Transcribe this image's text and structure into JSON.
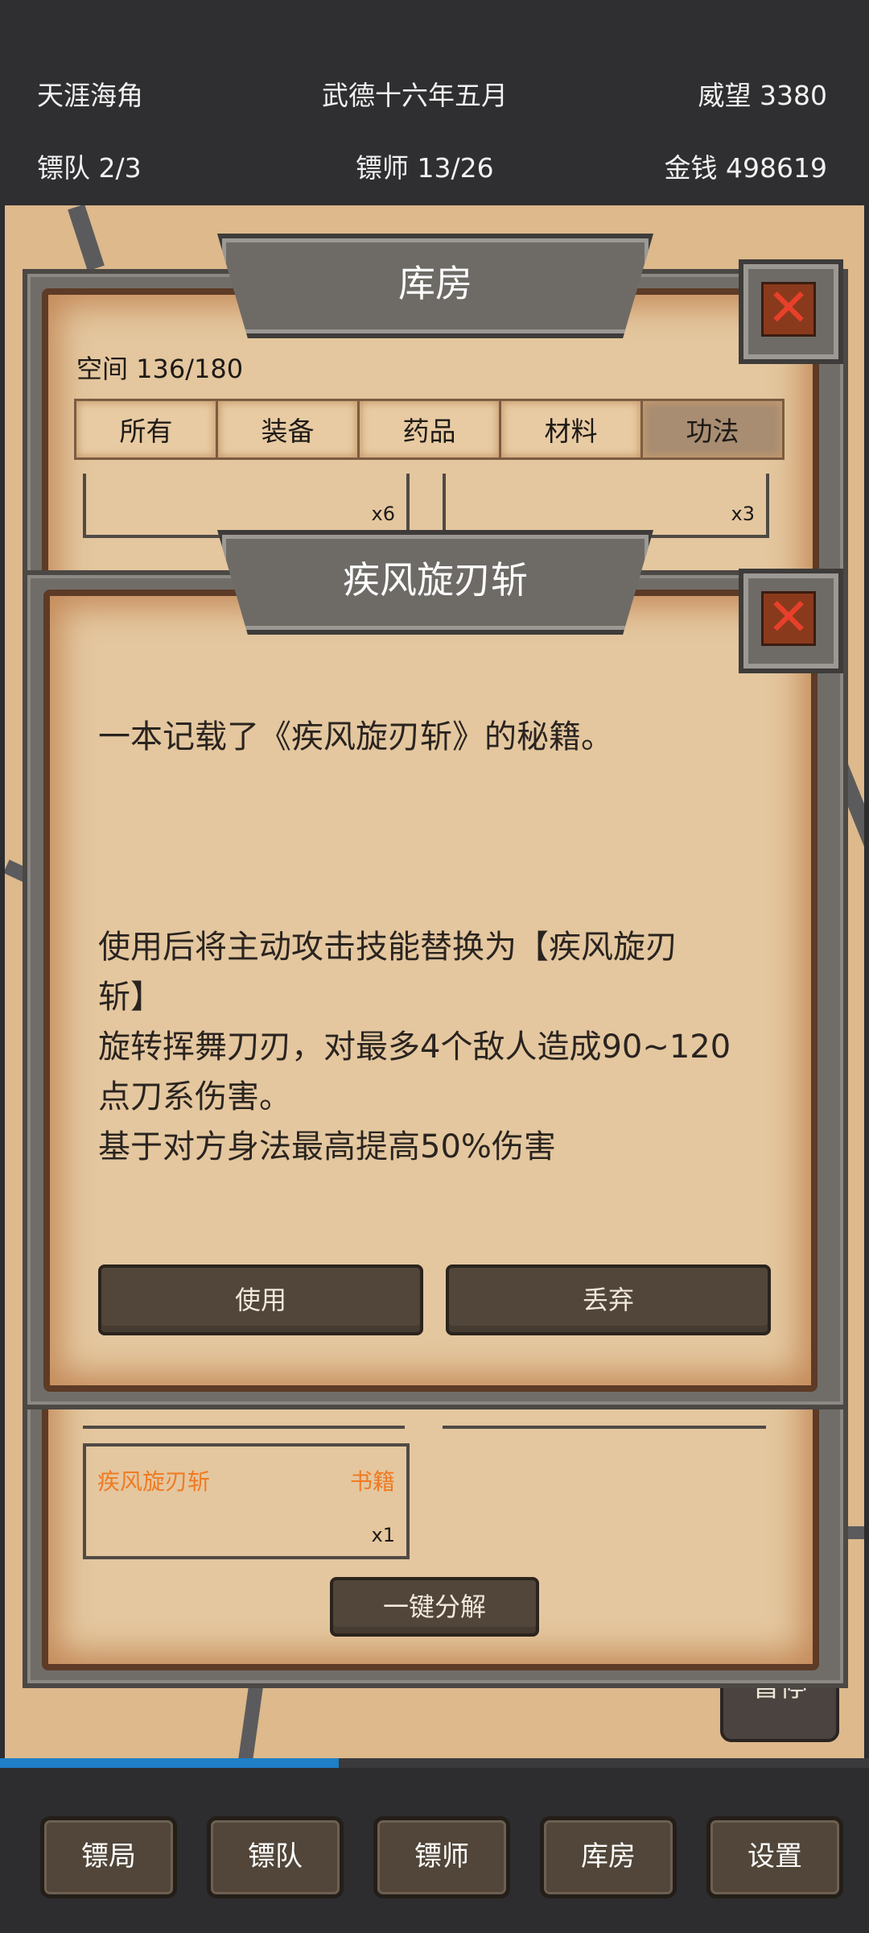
{
  "header": {
    "location": "天涯海角",
    "date": "武德十六年五月",
    "prestige": "威望 3380",
    "caravan": "镖队 2/3",
    "escorts": "镖师 13/26",
    "money": "金钱  498619"
  },
  "progress": {
    "fraction": 0.39
  },
  "pause_label": "暂停",
  "storage": {
    "title": "库房",
    "space": "空间 136/180",
    "tabs": [
      "所有",
      "装备",
      "药品",
      "材料",
      "功法"
    ],
    "active_tab": "功法",
    "slots": [
      {
        "qty": "x6"
      },
      {
        "qty": "x3"
      },
      {
        "name": "疾风旋刃斩",
        "type": "书籍",
        "qty": "x1"
      }
    ],
    "decompose_label": "一键分解"
  },
  "detail": {
    "title": "疾风旋刃斩",
    "intro": "一本记载了《疾风旋刃斩》的秘籍。",
    "effect_1": "使用后将主动攻击技能替换为【疾风旋刃",
    "effect_2": "斩】",
    "effect_3": "旋转挥舞刀刃，对最多4个敌人造成90~120",
    "effect_4": "点刀系伤害。",
    "effect_5": "基于对方身法最高提高50%伤害",
    "use_label": "使用",
    "discard_label": "丢弃"
  },
  "close_icon": "close-x-icon",
  "nav": [
    "镖局",
    "镖队",
    "镖师",
    "库房",
    "设置"
  ],
  "colors": {
    "accent_orange": "#f07b24",
    "progress_blue": "#1f7fc7",
    "parchment": "#e4c79f"
  }
}
